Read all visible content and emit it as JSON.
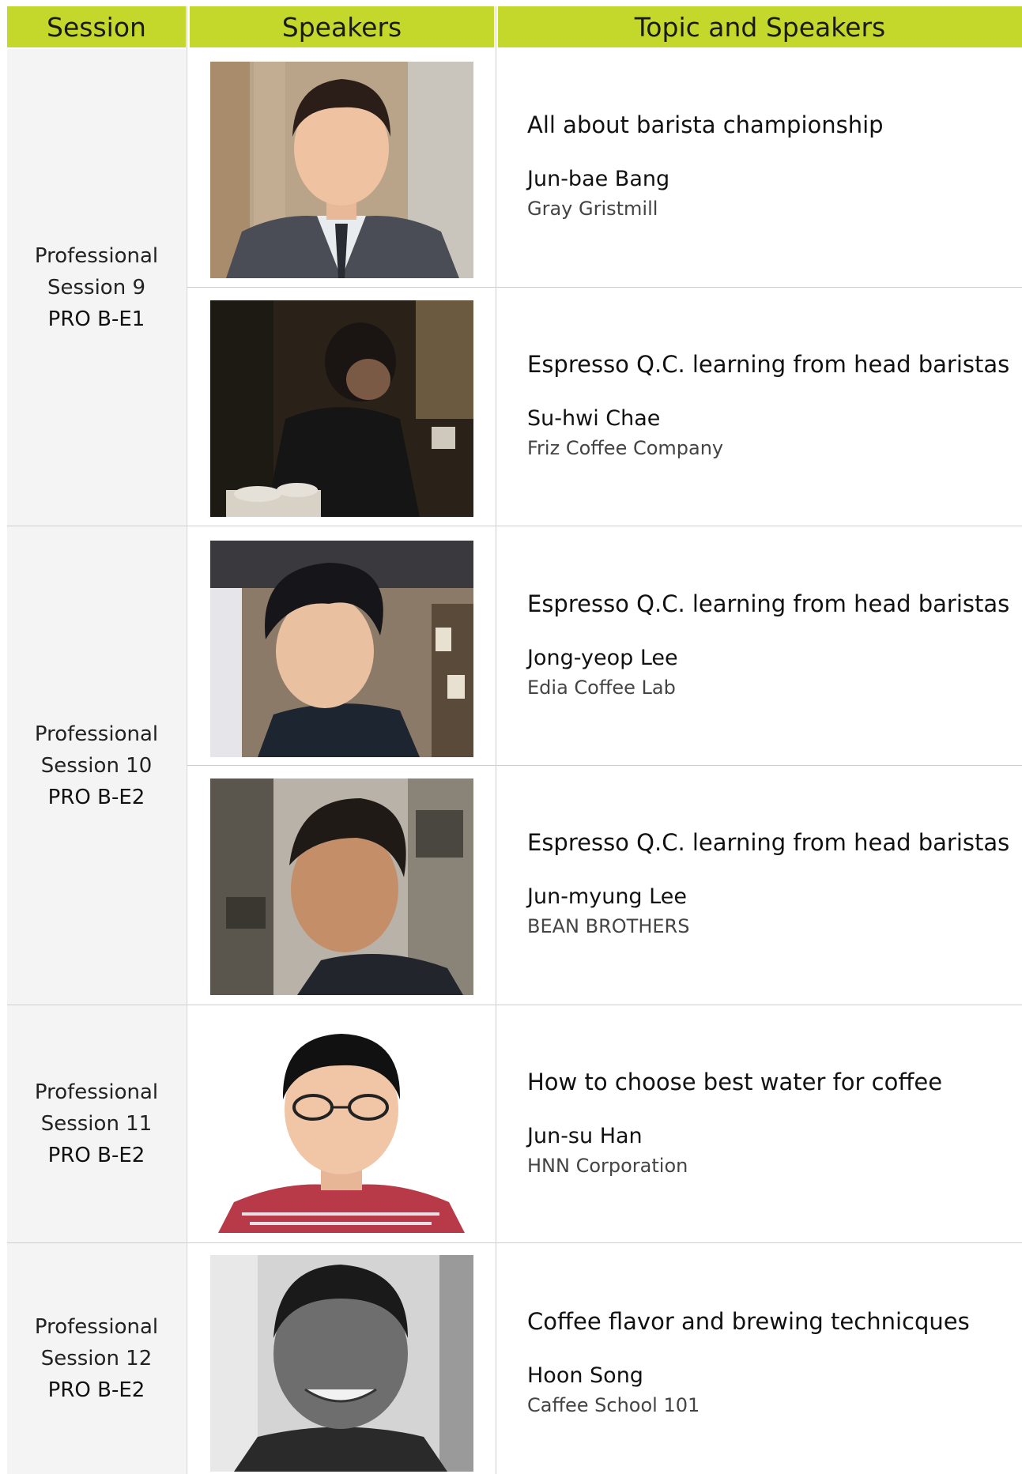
{
  "header": {
    "session": "Session",
    "speakers": "Speakers",
    "topic": "Topic and Speakers"
  },
  "sessions": [
    {
      "line1": "Professional",
      "line2": "Session 9",
      "code": "PRO B-E1"
    },
    {
      "line1": "Professional",
      "line2": "Session 10",
      "code": "PRO B-E2"
    },
    {
      "line1": "Professional",
      "line2": "Session 11",
      "code": "PRO B-E2"
    },
    {
      "line1": "Professional",
      "line2": "Session 12",
      "code": "PRO B-E2"
    }
  ],
  "talks": [
    {
      "title": "All about barista championship",
      "speaker": "Jun-bae Bang",
      "org": "Gray Gristmill"
    },
    {
      "title": "Espresso Q.C. learning from head baristas",
      "speaker": "Su-hwi Chae",
      "org": "Friz Coffee Company"
    },
    {
      "title": "Espresso Q.C. learning from head baristas",
      "speaker": "Jong-yeop Lee",
      "org": "Edia Coffee Lab"
    },
    {
      "title": "Espresso Q.C. learning from head baristas",
      "speaker": "Jun-myung Lee",
      "org": "BEAN BROTHERS"
    },
    {
      "title": "How to choose best water for coffee",
      "speaker": "Jun-su Han",
      "org": "HNN Corporation"
    },
    {
      "title": "Coffee flavor and brewing technicques",
      "speaker": "Hoon Song",
      "org": "Caffee School 101"
    }
  ]
}
